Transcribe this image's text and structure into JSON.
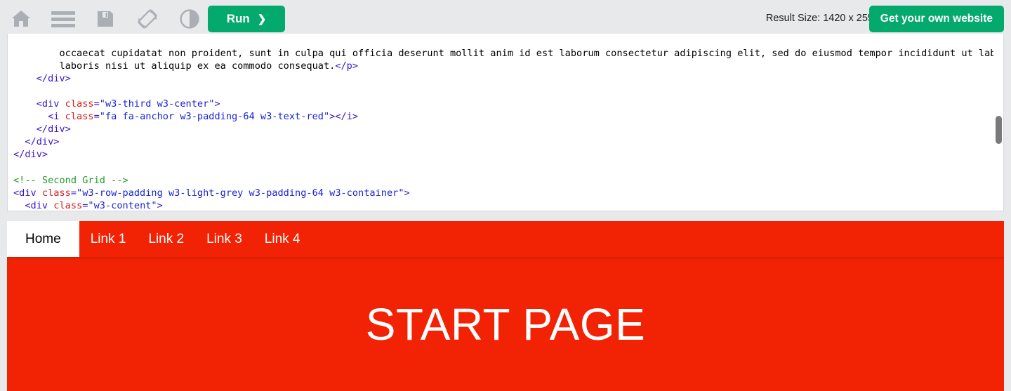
{
  "toolbar": {
    "icons": [
      {
        "name": "home-icon",
        "label": "Home"
      },
      {
        "name": "menu-icon",
        "label": "Menu"
      },
      {
        "name": "save-icon",
        "label": "Save"
      },
      {
        "name": "rotate-icon",
        "label": "Change Orientation"
      },
      {
        "name": "contrast-icon",
        "label": "Dark Mode"
      }
    ],
    "run_label": "Run",
    "run_chevron": "❯",
    "result_size": "Result Size: 1420 x 255",
    "get_website_label": "Get your own website"
  },
  "editor": {
    "lines": [
      [
        {
          "t": "txt",
          "s": "        occaecat cupidatat non proident, sunt in culpa qui officia deserunt mollit anim id est laborum consectetur adipiscing elit, sed do eiusmod tempor incididunt ut labore et dolore magna aliqua. Ut enim ad minim veniam, quis nostrud exercitation ullamco"
        }
      ],
      [
        {
          "t": "txt",
          "s": "        laboris nisi ut aliquip ex ea commodo consequat."
        },
        {
          "t": "tag",
          "s": "</p>"
        }
      ],
      [
        {
          "t": "txt",
          "s": "    "
        },
        {
          "t": "tag",
          "s": "</div>"
        }
      ],
      [],
      [
        {
          "t": "txt",
          "s": "    "
        },
        {
          "t": "tag",
          "s": "<div "
        },
        {
          "t": "attr",
          "s": "class"
        },
        {
          "t": "tag",
          "s": "="
        },
        {
          "t": "val",
          "s": "\"w3-third w3-center\""
        },
        {
          "t": "tag",
          "s": ">"
        }
      ],
      [
        {
          "t": "txt",
          "s": "      "
        },
        {
          "t": "tag",
          "s": "<i "
        },
        {
          "t": "attr",
          "s": "class"
        },
        {
          "t": "tag",
          "s": "="
        },
        {
          "t": "val",
          "s": "\"fa fa-anchor w3-padding-64 w3-text-red\""
        },
        {
          "t": "tag",
          "s": "></i>"
        }
      ],
      [
        {
          "t": "txt",
          "s": "    "
        },
        {
          "t": "tag",
          "s": "</div>"
        }
      ],
      [
        {
          "t": "txt",
          "s": "  "
        },
        {
          "t": "tag",
          "s": "</div>"
        }
      ],
      [
        {
          "t": "tag",
          "s": "</div>"
        }
      ],
      [],
      [
        {
          "t": "cmt",
          "s": "<!-- Second Grid -->"
        }
      ],
      [
        {
          "t": "tag",
          "s": "<div "
        },
        {
          "t": "attr",
          "s": "class"
        },
        {
          "t": "tag",
          "s": "="
        },
        {
          "t": "val",
          "s": "\"w3-row-padding w3-light-grey w3-padding-64 w3-container\""
        },
        {
          "t": "tag",
          "s": ">"
        }
      ],
      [
        {
          "t": "txt",
          "s": "  "
        },
        {
          "t": "tag",
          "s": "<div "
        },
        {
          "t": "attr",
          "s": "class"
        },
        {
          "t": "tag",
          "s": "="
        },
        {
          "t": "val",
          "s": "\"w3-content\""
        },
        {
          "t": "tag",
          "s": ">"
        }
      ]
    ]
  },
  "result": {
    "nav": [
      {
        "label": "Home",
        "active": true
      },
      {
        "label": "Link 1",
        "active": false
      },
      {
        "label": "Link 2",
        "active": false
      },
      {
        "label": "Link 3",
        "active": false
      },
      {
        "label": "Link 4",
        "active": false
      }
    ],
    "hero_title": "START PAGE"
  },
  "colors": {
    "toolbar_bg": "#e7e9eb",
    "accent_green": "#04AA6D",
    "result_red": "#f22204",
    "code_tag": "#3a16c7",
    "code_attr": "#d81b1b",
    "code_value": "#1924d6",
    "code_comment": "#1f9c28"
  }
}
